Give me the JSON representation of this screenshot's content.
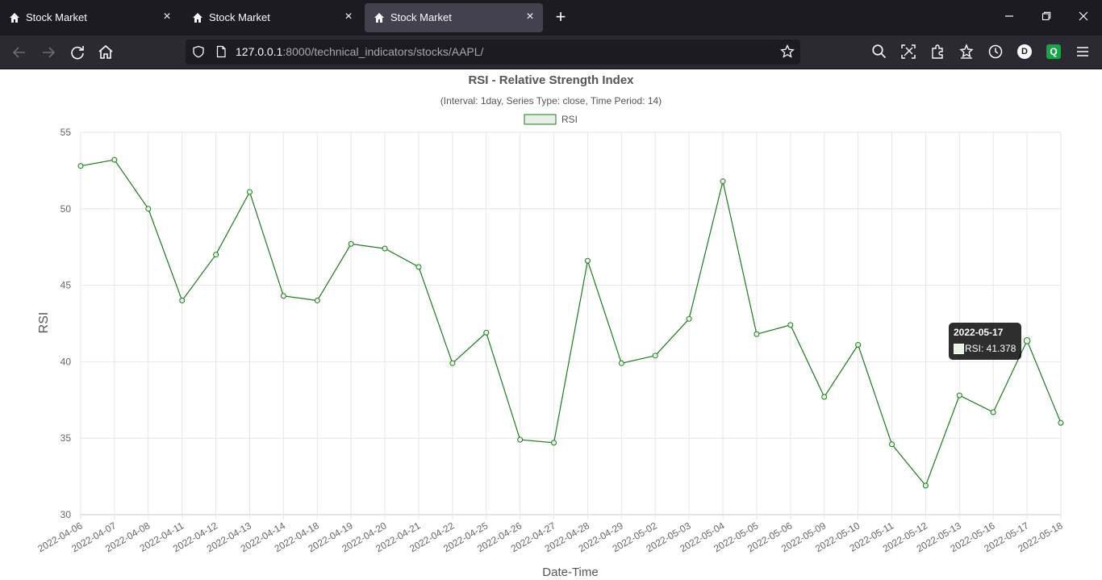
{
  "browser": {
    "tabs": [
      {
        "title": "Stock Market",
        "active": false
      },
      {
        "title": "Stock Market",
        "active": false
      },
      {
        "title": "Stock Market",
        "active": true
      }
    ],
    "url_host": "127.0.0.1",
    "url_rest": ":8000/technical_indicators/stocks/AAPL/",
    "profile_initial": "D",
    "extension_initial": "Q"
  },
  "chart_data": {
    "type": "line",
    "title": "RSI - Relative Strength Index",
    "subtitle": "(Interval: 1day, Series Type: close, Time Period: 14)",
    "xlabel": "Date-Time",
    "ylabel": "RSI",
    "ylim": [
      30,
      55
    ],
    "yticks": [
      30,
      35,
      40,
      45,
      50,
      55
    ],
    "grid": true,
    "legend_position": "top",
    "series_color": "#1f7a1f",
    "categories": [
      "2022-04-06",
      "2022-04-07",
      "2022-04-08",
      "2022-04-11",
      "2022-04-12",
      "2022-04-13",
      "2022-04-14",
      "2022-04-18",
      "2022-04-19",
      "2022-04-20",
      "2022-04-21",
      "2022-04-22",
      "2022-04-25",
      "2022-04-26",
      "2022-04-27",
      "2022-04-28",
      "2022-04-29",
      "2022-05-02",
      "2022-05-03",
      "2022-05-04",
      "2022-05-05",
      "2022-05-06",
      "2022-05-09",
      "2022-05-10",
      "2022-05-11",
      "2022-05-12",
      "2022-05-13",
      "2022-05-16",
      "2022-05-17",
      "2022-05-18"
    ],
    "series": [
      {
        "name": "RSI",
        "values": [
          52.8,
          53.2,
          50.0,
          44.0,
          47.0,
          51.1,
          44.3,
          44.0,
          47.7,
          47.4,
          46.2,
          39.9,
          41.9,
          34.9,
          34.7,
          46.6,
          39.9,
          40.4,
          42.8,
          51.8,
          41.8,
          42.4,
          37.7,
          41.1,
          34.6,
          31.9,
          37.8,
          36.7,
          41.378,
          36.0
        ]
      }
    ],
    "tooltip": {
      "title": "2022-05-17",
      "body": "RSI: 41.378"
    }
  }
}
